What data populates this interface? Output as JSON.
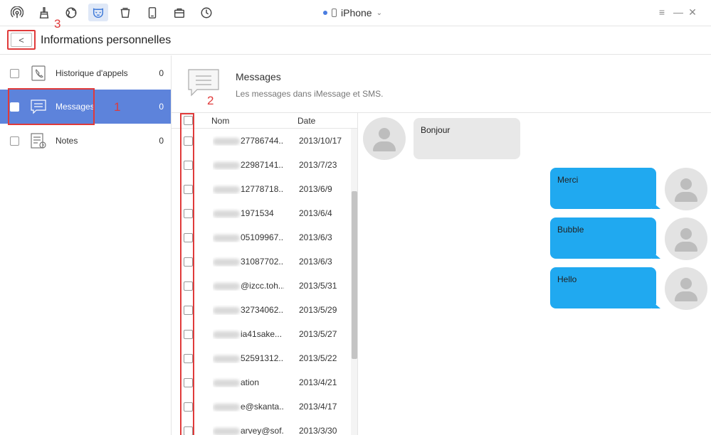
{
  "app": {
    "toolbar": [
      "wifi-icon",
      "broom-icon",
      "globe-icon",
      "mask-icon",
      "trash-icon",
      "tablet-icon",
      "toolbox-icon",
      "history-icon"
    ],
    "active_tool": "mask-icon",
    "device_name": "iPhone",
    "window_controls": {
      "menu": "≡",
      "minimize": "—",
      "close": "✕"
    }
  },
  "header": {
    "back_label": "<",
    "title": "Informations personnelles"
  },
  "annotations": {
    "one": "1",
    "two": "2",
    "three": "3"
  },
  "sidebar": {
    "items": [
      {
        "label": "Historique d'appels",
        "count": "0",
        "icon": "phone-icon"
      },
      {
        "label": "Messages",
        "count": "0",
        "icon": "message-icon"
      },
      {
        "label": "Notes",
        "count": "0",
        "icon": "notes-icon"
      }
    ]
  },
  "content": {
    "title": "Messages",
    "subtitle": "Les messages dans iMessage et SMS."
  },
  "list": {
    "col_name": "Nom",
    "col_date": "Date",
    "rows": [
      {
        "name": "27786744...",
        "date": "2013/10/17"
      },
      {
        "name": "22987141...",
        "date": "2013/7/23"
      },
      {
        "name": "12778718...",
        "date": "2013/6/9"
      },
      {
        "name": "1971534",
        "date": "2013/6/4"
      },
      {
        "name": "05109967...",
        "date": "2013/6/3"
      },
      {
        "name": "31087702...",
        "date": "2013/6/3"
      },
      {
        "name": "@izcc.toh...",
        "date": "2013/5/31"
      },
      {
        "name": "32734062...",
        "date": "2013/5/29"
      },
      {
        "name": "ia41sake...",
        "date": "2013/5/27"
      },
      {
        "name": "52591312...",
        "date": "2013/5/22"
      },
      {
        "name": "ation",
        "date": "2013/4/21"
      },
      {
        "name": "e@skanta...",
        "date": "2013/4/17"
      },
      {
        "name": "arvey@sof...",
        "date": "2013/3/30"
      }
    ]
  },
  "chat": {
    "messages": [
      {
        "text": "Bonjour",
        "direction": "in"
      },
      {
        "text": "Merci",
        "direction": "out"
      },
      {
        "text": "Bubble",
        "direction": "out"
      },
      {
        "text": "Hello",
        "direction": "out"
      }
    ],
    "colors": {
      "outgoing": "#20a9f0",
      "incoming": "#e8e8e8",
      "selection": "#5d83db",
      "annotation": "#e03a3a"
    }
  }
}
